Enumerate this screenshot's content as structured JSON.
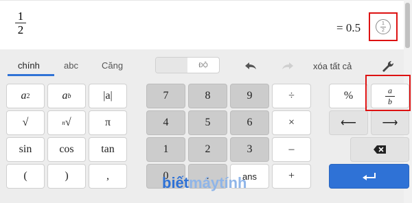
{
  "expression": {
    "numerator": "1",
    "denominator": "2",
    "result": "= 0.5"
  },
  "tabs": [
    {
      "label": "chính",
      "active": true
    },
    {
      "label": "abc",
      "active": false
    },
    {
      "label": "Căng",
      "active": false
    }
  ],
  "unit_toggle": {
    "left": "",
    "right": "ĐỘ"
  },
  "toolbar": {
    "clear_all": "xóa tất cả",
    "undo_icon": "undo-icon",
    "redo_icon": "redo-icon",
    "settings_icon": "wrench-icon"
  },
  "keys": {
    "abs": "|a|",
    "sqrt": "√",
    "pi": "π",
    "sin": "sin",
    "cos": "cos",
    "tan": "tan",
    "lparen": "(",
    "rparen": ")",
    "comma": ",",
    "n7": "7",
    "n8": "8",
    "n9": "9",
    "n4": "4",
    "n5": "5",
    "n6": "6",
    "n1": "1",
    "n2": "2",
    "n3": "3",
    "n0": "0",
    "dot": ".",
    "ans": "ans",
    "divide": "÷",
    "multiply": "×",
    "minus": "–",
    "plus": "+",
    "percent": "%",
    "frac_a": "a",
    "frac_b": "b",
    "left_arrow": "⟵",
    "right_arrow": "⟶",
    "backspace_icon": "backspace-icon",
    "enter_icon": "enter-icon"
  },
  "watermark": {
    "part1": "biết",
    "part2": "máytính"
  },
  "colors": {
    "accent": "#2f72d6",
    "highlight": "#dd1111"
  }
}
